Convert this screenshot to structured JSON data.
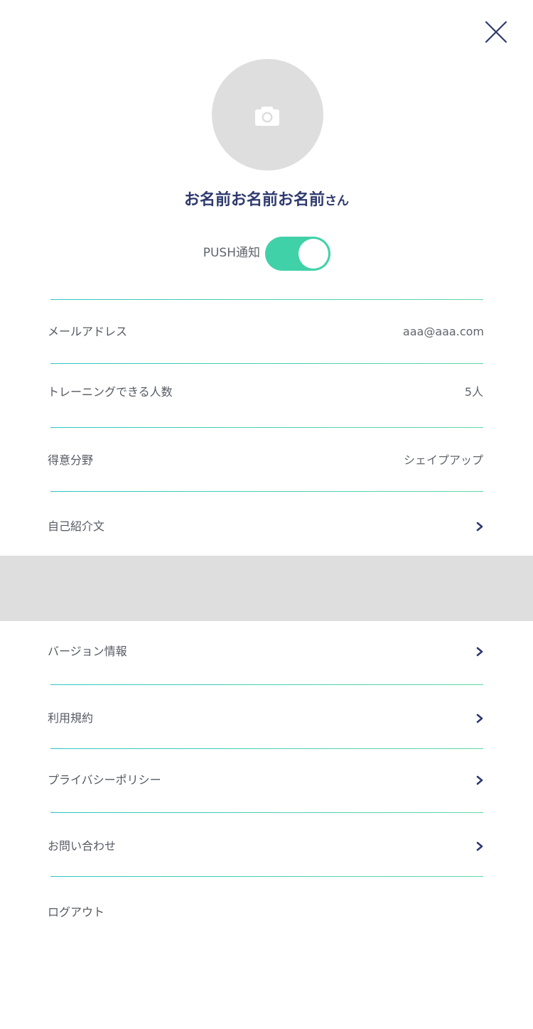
{
  "icons": {
    "close": "close-icon",
    "camera": "camera-icon",
    "chevron": "chevron-right-icon"
  },
  "colors": {
    "accent": "#41d1a8",
    "name_text": "#2f3a6e",
    "divider": "#2fc6c2",
    "avatar_bg": "#dedede",
    "chevron": "#2f3a6e"
  },
  "profile": {
    "name": "お名前お名前お名前",
    "name_suffix": "さん"
  },
  "push": {
    "label": "PUSH通知",
    "enabled": true
  },
  "info_rows": [
    {
      "label": "メールアドレス",
      "value": "aaa@aaa.com"
    },
    {
      "label": "トレーニングできる人数",
      "value": "5人"
    },
    {
      "label": "得意分野",
      "value": "シェイプアップ"
    },
    {
      "label": "自己紹介文"
    }
  ],
  "menu_rows": [
    {
      "label": "バージョン情報"
    },
    {
      "label": "利用規約"
    },
    {
      "label": "プライバシーポリシー"
    },
    {
      "label": "お問い合わせ"
    },
    {
      "label": "ログアウト"
    }
  ]
}
